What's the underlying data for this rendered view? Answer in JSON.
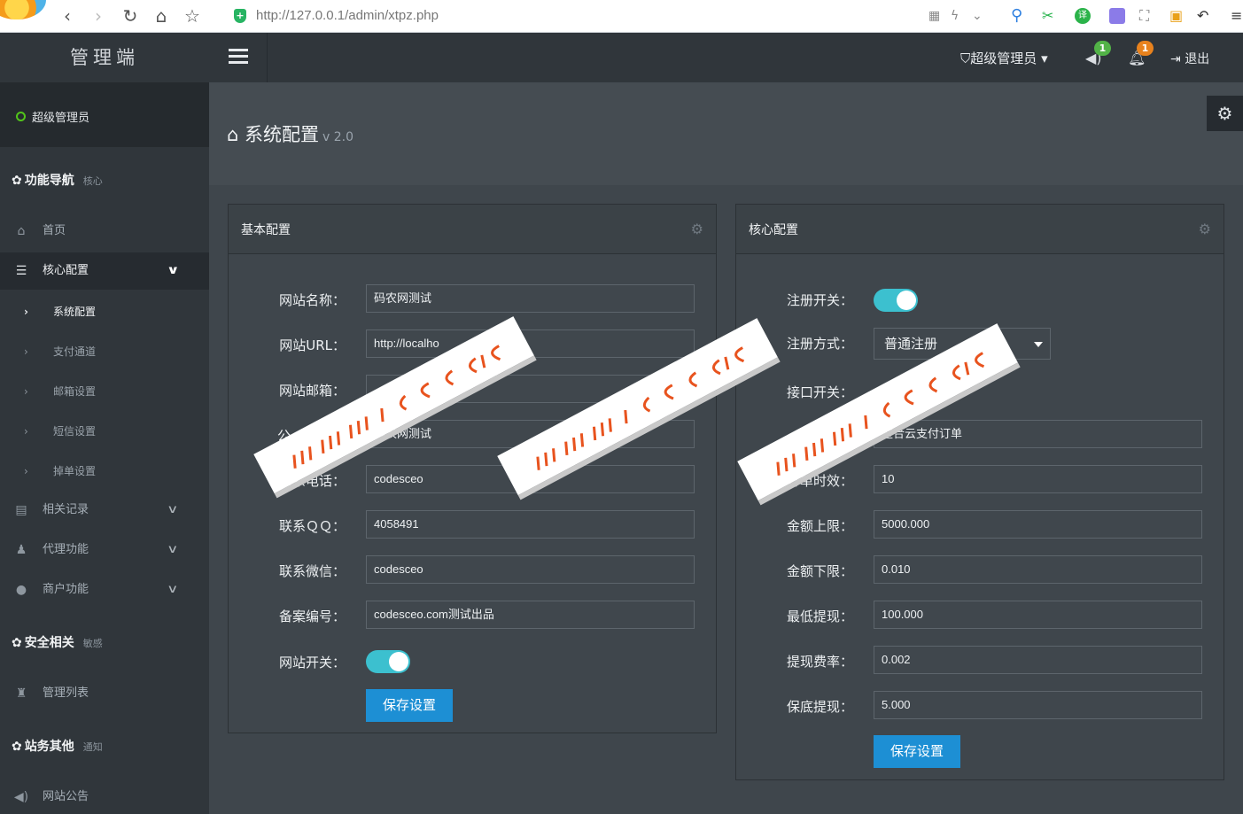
{
  "browser": {
    "url": "http://127.0.0.1/admin/xtpz.php",
    "secure_icon": "shield-icon"
  },
  "brand": "管理端",
  "profile": {
    "name": "超级管理员",
    "status_color": "#52c41a"
  },
  "sidebar": {
    "sections": [
      {
        "icon": "gear-icon",
        "label": "功能导航",
        "sub": "核心"
      },
      {
        "icon": "gear-icon",
        "label": "安全相关",
        "sub": "敏感"
      },
      {
        "icon": "gear-icon",
        "label": "站务其他",
        "sub": "通知"
      }
    ],
    "items": {
      "home": "首页",
      "core": "核心配置",
      "records": "相关记录",
      "agent": "代理功能",
      "merchant": "商户功能",
      "admin_list": "管理列表",
      "notice": "网站公告"
    },
    "sub_items": [
      "系统配置",
      "支付通道",
      "邮箱设置",
      "短信设置",
      "掉单设置"
    ]
  },
  "topbar": {
    "admin_label": "超级管理员",
    "speaker_badge": "1",
    "bell_badge": "1",
    "logout": "退出",
    "speaker_badge_color": "#52b347",
    "bell_badge_color": "#e8821d"
  },
  "page": {
    "title": "系统配置",
    "version": "v 2.0"
  },
  "basic": {
    "title": "基本配置",
    "fields": [
      {
        "label": "网站名称：",
        "value": "码农网测试"
      },
      {
        "label": "网站URL：",
        "value": "http://localho"
      },
      {
        "label": "网站邮箱：",
        "value": "ceo.com"
      },
      {
        "label": "公",
        "value": "码农网测试"
      },
      {
        "label": "联系电话：",
        "value": "codesceo"
      },
      {
        "label": "联系ＱＱ：",
        "value": "4058491"
      },
      {
        "label": "联系微信：",
        "value": "codesceo"
      },
      {
        "label": "备案编号：",
        "value": "codesceo.com测试出品"
      }
    ],
    "switch_label": "网站开关：",
    "save": "保存设置"
  },
  "core": {
    "title": "核心配置",
    "reg_switch_label": "注册开关：",
    "reg_mode_label": "注册方式：",
    "reg_mode_value": "普通注册",
    "api_switch_label": "接口开关：",
    "fields": [
      {
        "label": "",
        "value": "整合云支付订单"
      },
      {
        "label": "订单时效：",
        "value": "10"
      },
      {
        "label": "金额上限：",
        "value": "5000.000"
      },
      {
        "label": "金额下限：",
        "value": "0.010"
      },
      {
        "label": "最低提现：",
        "value": "100.000"
      },
      {
        "label": "提现费率：",
        "value": "0.002"
      },
      {
        "label": "保底提现：",
        "value": "5.000"
      }
    ],
    "save": "保存设置"
  },
  "watermark": "www.soscw.com",
  "colors": {
    "accent": "#1d8fd4",
    "toggle": "#3cc0cf",
    "sidebar": "#30363b",
    "watermark_text": "#e8531e"
  }
}
